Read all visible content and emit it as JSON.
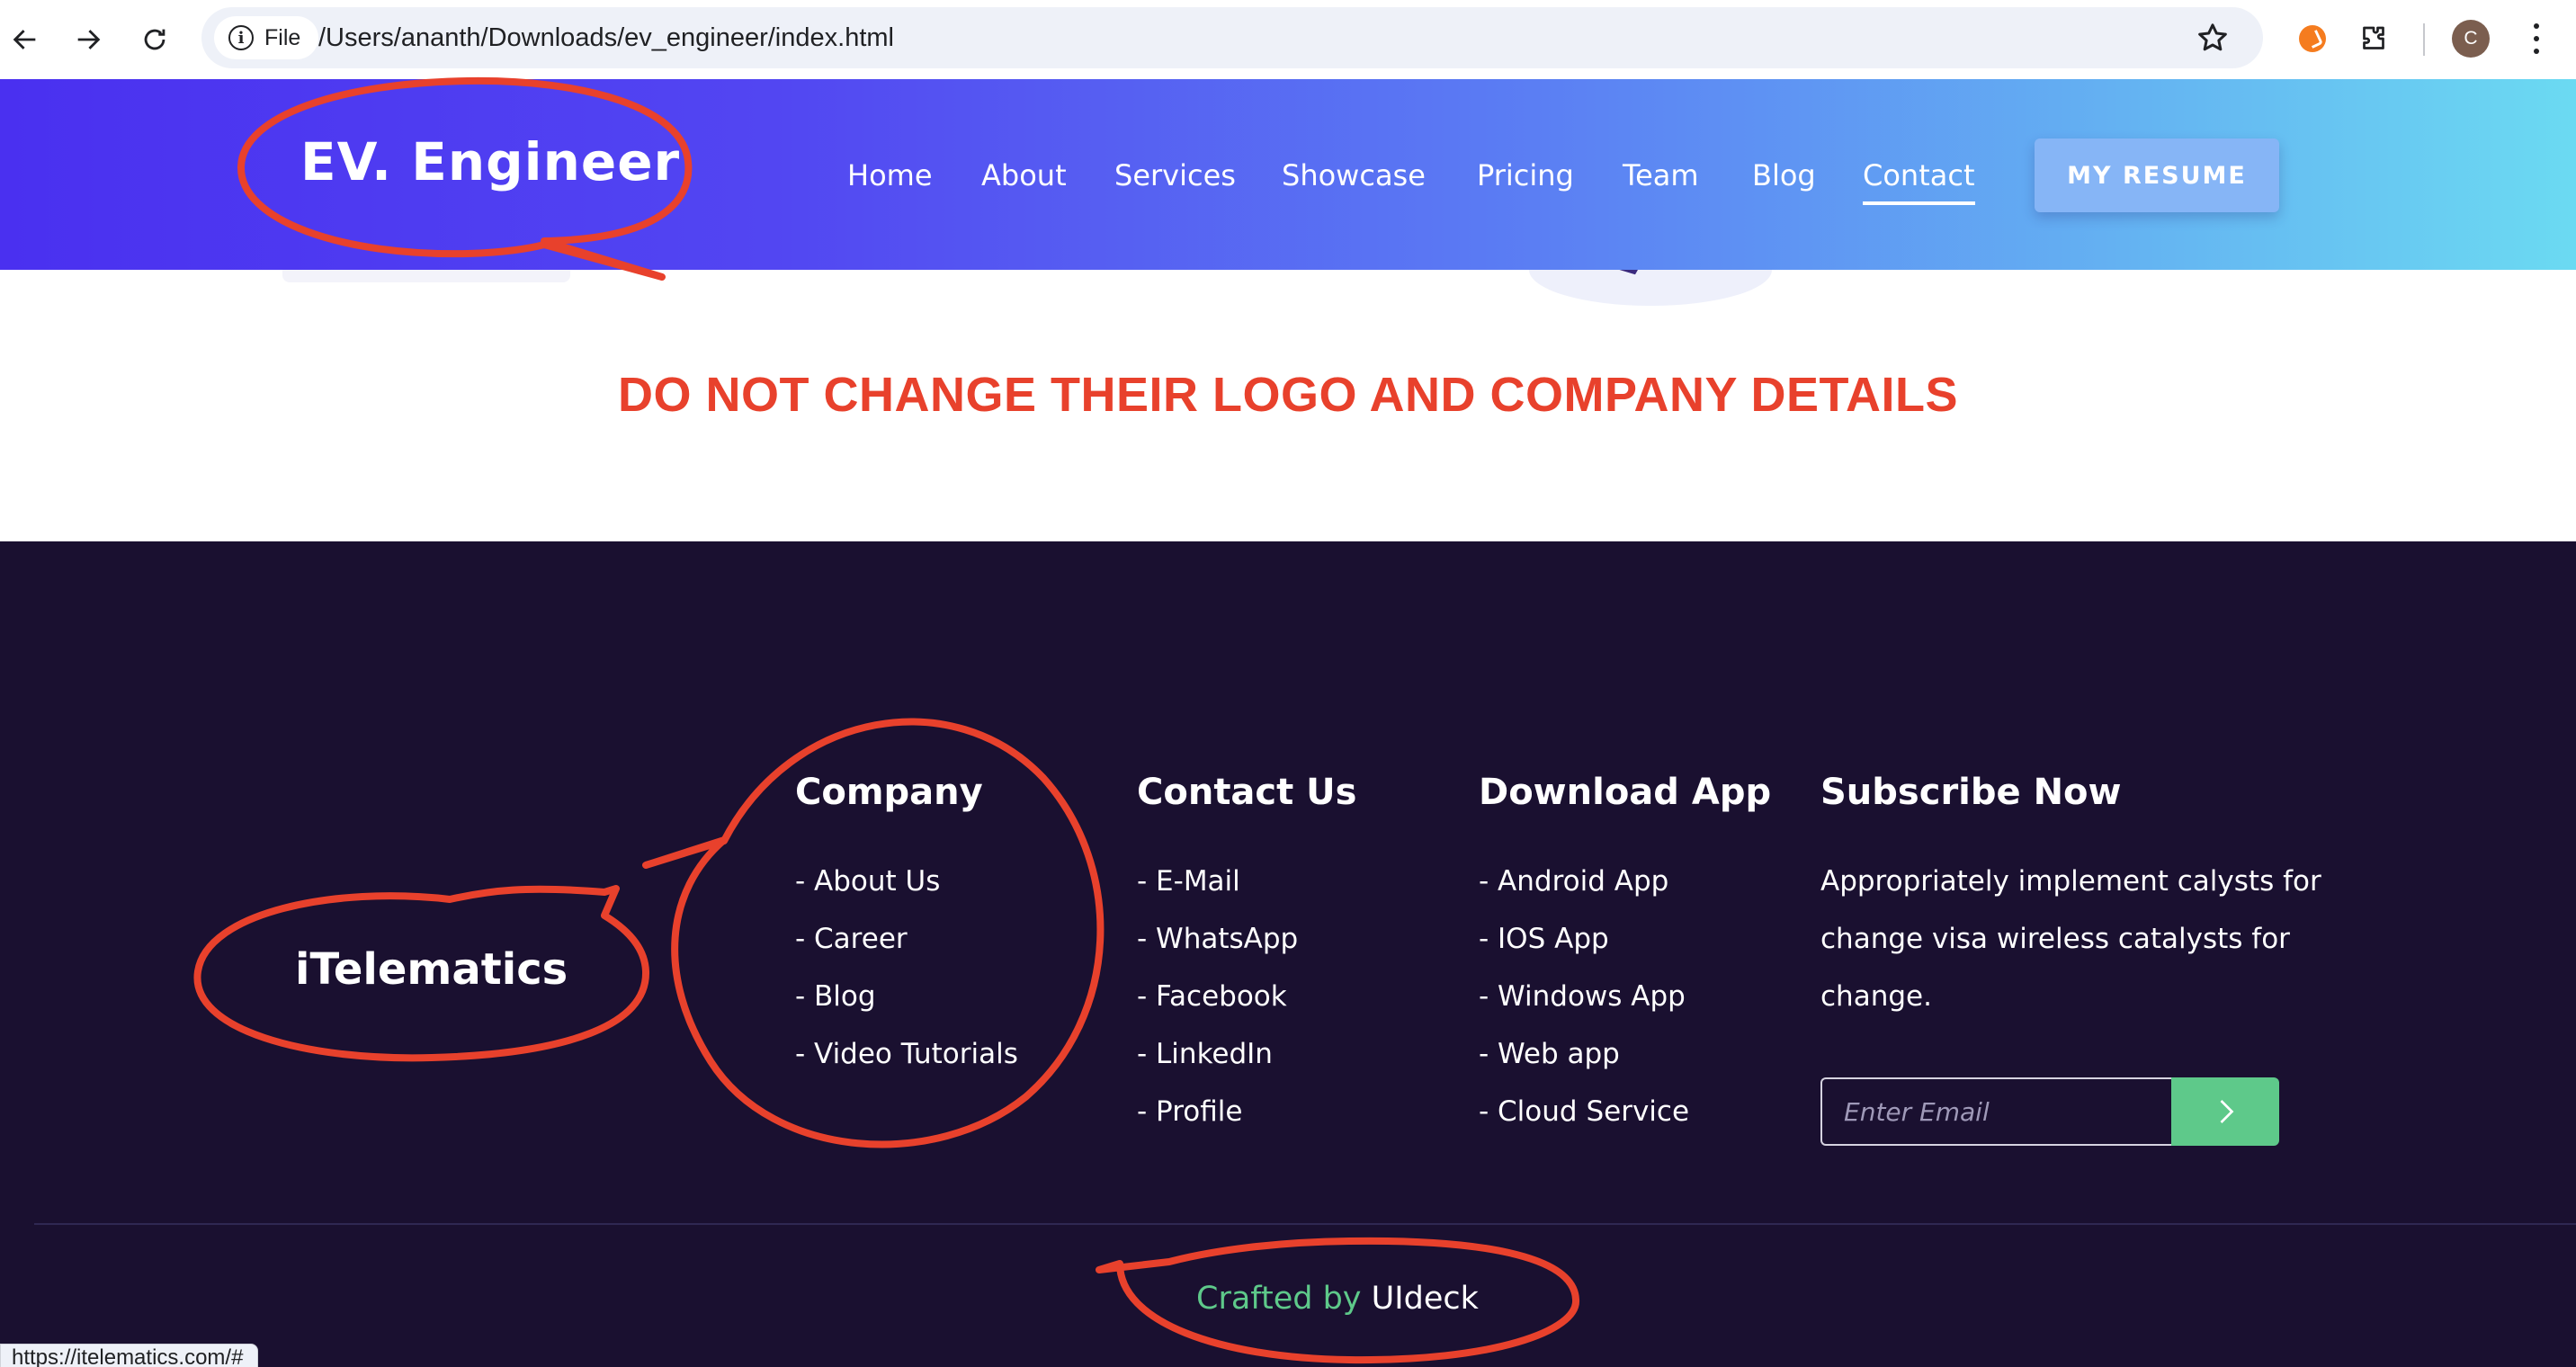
{
  "browser": {
    "site_chip_label": "File",
    "url": "/Users/ananth/Downloads/ev_engineer/index.html",
    "profile_initial": "C",
    "status_url": "https://itelematics.com/#"
  },
  "header": {
    "logo": "EV. Engineer",
    "menu": [
      "Home",
      "About",
      "Services",
      "Showcase",
      "Pricing",
      "Team",
      "Blog",
      "Contact"
    ],
    "active_menu": "Contact",
    "resume_button": "MY RESUME"
  },
  "content": {
    "notice": "DO NOT CHANGE THEIR LOGO AND COMPANY DETAILS"
  },
  "footer": {
    "brand": "iTelematics",
    "columns": [
      {
        "title": "Company",
        "items": [
          "- About Us",
          "- Career",
          "- Blog",
          "- Video Tutorials"
        ]
      },
      {
        "title": "Contact Us",
        "items": [
          "- E-Mail",
          "- WhatsApp",
          "- Facebook",
          "- LinkedIn",
          "- Profile"
        ]
      },
      {
        "title": "Download App",
        "items": [
          "- Android App",
          "- IOS App",
          "- Windows App",
          "- Web app",
          "- Cloud Service"
        ]
      }
    ],
    "subscribe": {
      "title": "Subscribe Now",
      "text": "Appropriately implement calysts for change visa wireless catalysts for change.",
      "placeholder": "Enter Email"
    },
    "credit_prefix": "Crafted by",
    "credit_name": "UIdeck"
  },
  "colors": {
    "header_gradient_start": "#4a30f0",
    "header_gradient_end": "#6bdaf2",
    "footer_bg": "#1a1030",
    "annotation_red": "#e8412c",
    "accent_green": "#5ec98a"
  }
}
